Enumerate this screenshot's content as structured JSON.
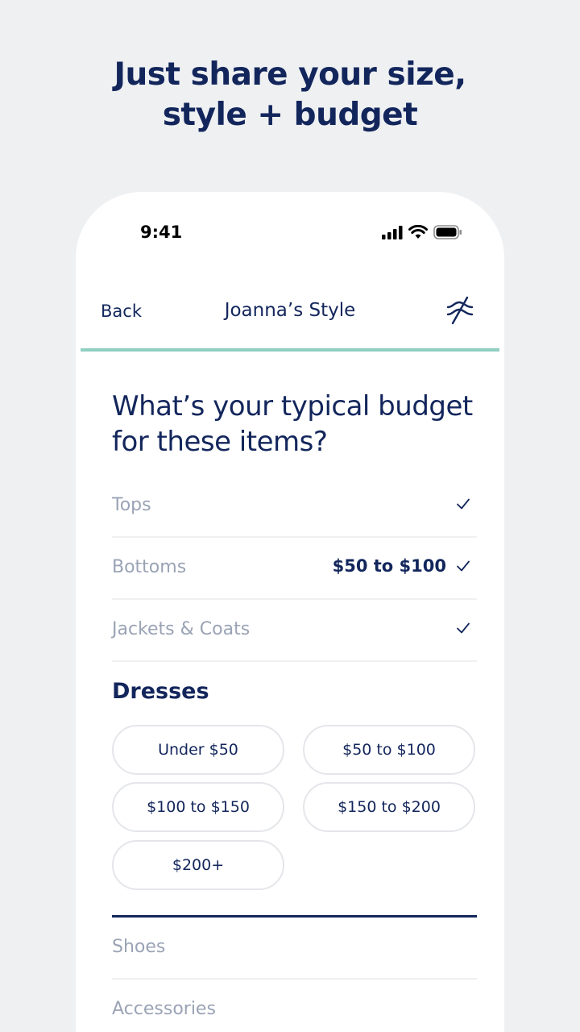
{
  "hero": {
    "line1": "Just share your size,",
    "line2": "style + budget"
  },
  "status_bar": {
    "time": "9:41",
    "icons": [
      "signal-icon",
      "wifi-icon",
      "battery-icon"
    ]
  },
  "nav": {
    "back_label": "Back",
    "title": "Joanna’s Style",
    "filter_icon": "filter-icon"
  },
  "question": {
    "line1": "What’s your typical budget",
    "line2": "for these items?"
  },
  "categories": [
    {
      "label": "Tops",
      "value": "",
      "checked": true
    },
    {
      "label": "Bottoms",
      "value": "$50 to $100",
      "checked": true
    },
    {
      "label": "Jackets & Coats",
      "value": "",
      "checked": true
    }
  ],
  "dresses": {
    "title": "Dresses",
    "options": [
      "Under $50",
      "$50 to $100",
      "$100 to $150",
      "$150 to $200",
      "$200+"
    ]
  },
  "more_categories": [
    {
      "label": "Shoes"
    },
    {
      "label": "Accessories"
    }
  ],
  "colors": {
    "navy": "#13265c",
    "muted_text": "#9aa3b5",
    "progress_accent": "#8fcfc0",
    "background": "#eef0f2"
  }
}
